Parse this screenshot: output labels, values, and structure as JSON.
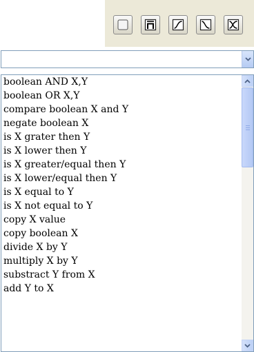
{
  "toolbar": {
    "buttons": [
      {
        "icon": "blank-square-icon"
      },
      {
        "icon": "n-bar-icon"
      },
      {
        "icon": "rising-curve-icon"
      },
      {
        "icon": "falling-curve-icon"
      },
      {
        "icon": "crossed-curves-icon"
      }
    ]
  },
  "combo": {
    "value": ""
  },
  "list": {
    "items": [
      "boolean AND X,Y",
      "boolean OR X,Y",
      "compare boolean X and Y",
      "negate boolean X",
      "is X grater then Y",
      "is X lower then Y",
      "is X greater/equal then Y",
      "is X lower/equal then Y",
      "is X equal to Y",
      "is X not equal to Y",
      "copy X value",
      "copy boolean X",
      "divide X by Y",
      "multiply X by Y",
      "substract Y from X",
      "add Y to X"
    ]
  },
  "colors": {
    "toolbar_bg": "#ece9d8",
    "border": "#7f9db9",
    "scroll_accent": "#4d6185"
  }
}
